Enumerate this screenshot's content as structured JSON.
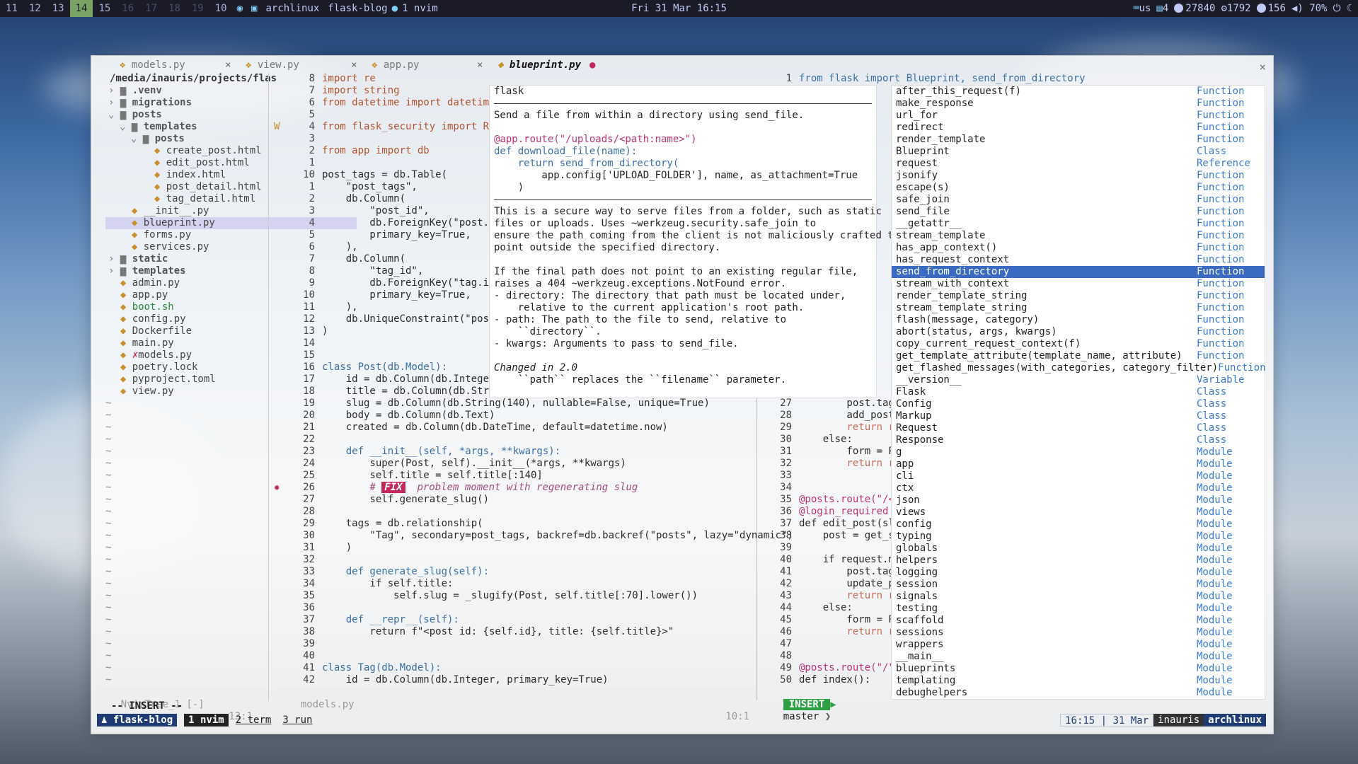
{
  "topbar": {
    "workspaces": [
      {
        "label": "11",
        "state": "normal"
      },
      {
        "label": "12",
        "state": "normal"
      },
      {
        "label": "13",
        "state": "normal"
      },
      {
        "label": "14",
        "state": "active"
      },
      {
        "label": "15",
        "state": "normal"
      },
      {
        "label": "16",
        "state": "dim"
      },
      {
        "label": "17",
        "state": "dim"
      },
      {
        "label": "18",
        "state": "dim"
      },
      {
        "label": "19",
        "state": "dim"
      },
      {
        "label": "10",
        "state": "normal"
      }
    ],
    "window_title_host": "archlinux",
    "window_title_session": "flask-blog",
    "window_title_pane": "1 nvim",
    "clock": "Fri 31 Mar 16:15",
    "tray": {
      "keyboard": "us",
      "windows": "4",
      "coins": "27840",
      "memory": "1792",
      "temp": "156",
      "volume": "70%"
    }
  },
  "window": {
    "close_label": "×"
  },
  "tabs": [
    {
      "label": "models.py",
      "close": "×",
      "current": false
    },
    {
      "label": "view.py",
      "close": "×",
      "current": false
    },
    {
      "label": "app.py",
      "close": "×",
      "current": false
    },
    {
      "label": "blueprint.py",
      "close": "●",
      "current": true
    }
  ],
  "tree": {
    "root": "/media/inauris/projects/flas",
    "items": [
      {
        "indent": 0,
        "fold": ">",
        "name": ".venv",
        "type": "dir"
      },
      {
        "indent": 0,
        "fold": ">",
        "name": "migrations",
        "type": "dir"
      },
      {
        "indent": 0,
        "fold": "v",
        "name": "posts",
        "type": "dir"
      },
      {
        "indent": 1,
        "fold": "v",
        "name": "templates",
        "type": "dir"
      },
      {
        "indent": 2,
        "fold": "v",
        "name": "posts",
        "type": "dir"
      },
      {
        "indent": 3,
        "fold": "",
        "name": "create_post.html",
        "type": "file"
      },
      {
        "indent": 3,
        "fold": "",
        "name": "edit_post.html",
        "type": "file"
      },
      {
        "indent": 3,
        "fold": "",
        "name": "index.html",
        "type": "file"
      },
      {
        "indent": 3,
        "fold": "",
        "name": "post_detail.html",
        "type": "file"
      },
      {
        "indent": 3,
        "fold": "",
        "name": "tag_detail.html",
        "type": "file"
      },
      {
        "indent": 1,
        "fold": "",
        "name": "__init__.py",
        "type": "file"
      },
      {
        "indent": 1,
        "fold": "",
        "name": "blueprint.py",
        "type": "file",
        "selected": true
      },
      {
        "indent": 1,
        "fold": "",
        "name": "forms.py",
        "type": "file"
      },
      {
        "indent": 1,
        "fold": "",
        "name": "services.py",
        "type": "file"
      },
      {
        "indent": 0,
        "fold": ">",
        "name": "static",
        "type": "dir"
      },
      {
        "indent": 0,
        "fold": ">",
        "name": "templates",
        "type": "dir"
      },
      {
        "indent": 0,
        "fold": "",
        "name": "admin.py",
        "type": "file"
      },
      {
        "indent": 0,
        "fold": "",
        "name": "app.py",
        "type": "file"
      },
      {
        "indent": 0,
        "fold": "",
        "name": "boot.sh",
        "type": "file"
      },
      {
        "indent": 0,
        "fold": "",
        "name": "config.py",
        "type": "file"
      },
      {
        "indent": 0,
        "fold": "",
        "name": "Dockerfile",
        "type": "file"
      },
      {
        "indent": 0,
        "fold": "",
        "name": "main.py",
        "type": "file"
      },
      {
        "indent": 0,
        "fold": "",
        "name": "models.py",
        "type": "file",
        "modified": "✗"
      },
      {
        "indent": 0,
        "fold": "",
        "name": "poetry.lock",
        "type": "file"
      },
      {
        "indent": 0,
        "fold": "",
        "name": "pyproject.toml",
        "type": "file"
      },
      {
        "indent": 0,
        "fold": "",
        "name": "view.py",
        "type": "file"
      }
    ],
    "filler": "~"
  },
  "code_left": [
    {
      "n": "8",
      "t": "import re"
    },
    {
      "n": "7",
      "t": "import string"
    },
    {
      "n": "6",
      "t": "from datetime import datetime"
    },
    {
      "n": "5",
      "t": ""
    },
    {
      "n": "4",
      "t": "from flask_security import RoleM",
      "sign": "W"
    },
    {
      "n": "3",
      "t": ""
    },
    {
      "n": "2",
      "t": "from app import db"
    },
    {
      "n": "1",
      "t": ""
    },
    {
      "n": "10",
      "t": "post_tags = db.Table("
    },
    {
      "n": "1",
      "t": "    \"post_tags\","
    },
    {
      "n": "2",
      "t": "    db.Column("
    },
    {
      "n": "3",
      "t": "        \"post_id\","
    },
    {
      "n": "4",
      "t": "        db.ForeignKey(\"post.id\","
    },
    {
      "n": "5",
      "t": "        primary_key=True,"
    },
    {
      "n": "6",
      "t": "    ),"
    },
    {
      "n": "7",
      "t": "    db.Column("
    },
    {
      "n": "8",
      "t": "        \"tag_id\","
    },
    {
      "n": "9",
      "t": "        db.ForeignKey(\"tag.id\","
    },
    {
      "n": "10",
      "t": "        primary_key=True,"
    },
    {
      "n": "11",
      "t": "    ),"
    },
    {
      "n": "12",
      "t": "    db.UniqueConstraint(\"post_id"
    },
    {
      "n": "13",
      "t": ")"
    },
    {
      "n": "14",
      "t": ""
    },
    {
      "n": "15",
      "t": ""
    },
    {
      "n": "16",
      "t": "class Post(db.Model):"
    },
    {
      "n": "17",
      "t": "    id = db.Column(db.Integer, p"
    },
    {
      "n": "18",
      "t": "    title = db.Column(db.String("
    },
    {
      "n": "19",
      "t": "    slug = db.Column(db.String(140), nullable=False, unique=True)"
    },
    {
      "n": "20",
      "t": "    body = db.Column(db.Text)"
    },
    {
      "n": "21",
      "t": "    created = db.Column(db.DateTime, default=datetime.now)"
    },
    {
      "n": "22",
      "t": ""
    },
    {
      "n": "23",
      "t": "    def __init__(self, *args, **kwargs):"
    },
    {
      "n": "24",
      "t": "        super(Post, self).__init__(*args, **kwargs)"
    },
    {
      "n": "25",
      "t": "        self.title = self.title[:140]"
    },
    {
      "n": "26",
      "t": "        # FIX  problem moment with regenerating slug",
      "sign": "bug"
    },
    {
      "n": "27",
      "t": "        self.generate_slug()"
    },
    {
      "n": "28",
      "t": ""
    },
    {
      "n": "29",
      "t": "    tags = db.relationship("
    },
    {
      "n": "30",
      "t": "        \"Tag\", secondary=post_tags, backref=db.backref(\"posts\", lazy=\"dynamic\")"
    },
    {
      "n": "31",
      "t": "    )"
    },
    {
      "n": "32",
      "t": ""
    },
    {
      "n": "33",
      "t": "    def generate_slug(self):"
    },
    {
      "n": "34",
      "t": "        if self.title:"
    },
    {
      "n": "35",
      "t": "            self.slug = _slugify(Post, self.title[:70].lower())"
    },
    {
      "n": "36",
      "t": ""
    },
    {
      "n": "37",
      "t": "    def __repr__(self):"
    },
    {
      "n": "38",
      "t": "        return f\"<post id: {self.id}, title: {self.title}>\""
    },
    {
      "n": "39",
      "t": ""
    },
    {
      "n": "40",
      "t": ""
    },
    {
      "n": "41",
      "t": "class Tag(db.Model):"
    },
    {
      "n": "42",
      "t": "    id = db.Column(db.Integer, primary_key=True)"
    }
  ],
  "code_right_top": {
    "n": "1",
    "t": "from flask import Blueprint, send_from_directory"
  },
  "code_right": [
    {
      "n": "27",
      "t": "        post.tags"
    },
    {
      "n": "28",
      "t": "        add_post_"
    },
    {
      "n": "29",
      "t": "        return re"
    },
    {
      "n": "30",
      "t": "    else:"
    },
    {
      "n": "31",
      "t": "        form = Po"
    },
    {
      "n": "32",
      "t": "        return re"
    },
    {
      "n": "33",
      "t": ""
    },
    {
      "n": "34",
      "t": ""
    },
    {
      "n": "35",
      "t": "@posts.route(\"/<s"
    },
    {
      "n": "36",
      "t": "@login_required"
    },
    {
      "n": "37",
      "t": "def edit_post(slu"
    },
    {
      "n": "38",
      "t": "    post = get_sp"
    },
    {
      "n": "39",
      "t": ""
    },
    {
      "n": "40",
      "t": "    if request.me"
    },
    {
      "n": "41",
      "t": "        post.tags"
    },
    {
      "n": "42",
      "t": "        update_po"
    },
    {
      "n": "43",
      "t": "        return re"
    },
    {
      "n": "44",
      "t": "    else:"
    },
    {
      "n": "45",
      "t": "        form = Po"
    },
    {
      "n": "46",
      "t": "        return re"
    },
    {
      "n": "47",
      "t": ""
    },
    {
      "n": "48",
      "t": ""
    },
    {
      "n": "49",
      "t": "@posts.route(\"/\")"
    },
    {
      "n": "50",
      "t": "def index():"
    }
  ],
  "doc": {
    "title": "flask",
    "lines": [
      "Send a file from within a directory using send_file.",
      "",
      "@app.route(\"/uploads/<path:name>\")",
      "def download_file(name):",
      "    return send_from_directory(",
      "        app.config['UPLOAD_FOLDER'], name, as_attachment=True",
      "    )"
    ],
    "lines2": [
      "This is a secure way to serve files from a folder, such as static",
      "files or uploads. Uses ~werkzeug.security.safe_join to",
      "ensure the path coming from the client is not maliciously crafted to",
      "point outside the specified directory.",
      "",
      "If the final path does not point to an existing regular file,",
      "raises a 404 ~werkzeug.exceptions.NotFound error.",
      "- directory: The directory that path must be located under,",
      "    relative to the current application's root path.",
      "- path: The path to the file to send, relative to",
      "    ``directory``.",
      "- kwargs: Arguments to pass to send_file.",
      "",
      "Changed in 2.0",
      "    ``path`` replaces the ``filename`` parameter."
    ]
  },
  "completion": [
    {
      "label": "after_this_request(f)",
      "kind": "Function"
    },
    {
      "label": "make_response",
      "kind": "Function"
    },
    {
      "label": "url_for",
      "kind": "Function"
    },
    {
      "label": "redirect",
      "kind": "Function"
    },
    {
      "label": "render_template",
      "kind": "Function"
    },
    {
      "label": "Blueprint",
      "kind": "Class"
    },
    {
      "label": "request",
      "kind": "Reference"
    },
    {
      "label": "jsonify",
      "kind": "Function"
    },
    {
      "label": "escape(s)",
      "kind": "Function"
    },
    {
      "label": "safe_join",
      "kind": "Function"
    },
    {
      "label": "send_file",
      "kind": "Function"
    },
    {
      "label": "__getattr__",
      "kind": "Function"
    },
    {
      "label": "stream_template",
      "kind": "Function"
    },
    {
      "label": "has_app_context()",
      "kind": "Function"
    },
    {
      "label": "has_request_context",
      "kind": "Function"
    },
    {
      "label": "send_from_directory",
      "kind": "Function",
      "selected": true
    },
    {
      "label": "stream_with_context",
      "kind": "Function"
    },
    {
      "label": "render_template_string",
      "kind": "Function"
    },
    {
      "label": "stream_template_string",
      "kind": "Function"
    },
    {
      "label": "flash(message, category)",
      "kind": "Function"
    },
    {
      "label": "abort(status, args, kwargs)",
      "kind": "Function"
    },
    {
      "label": "copy_current_request_context(f)",
      "kind": "Function"
    },
    {
      "label": "get_template_attribute(template_name, attribute)",
      "kind": "Function"
    },
    {
      "label": "get_flashed_messages(with_categories, category_filter)",
      "kind": "Function"
    },
    {
      "label": "__version__",
      "kind": "Variable"
    },
    {
      "label": "Flask",
      "kind": "Class"
    },
    {
      "label": "Config",
      "kind": "Class"
    },
    {
      "label": "Markup",
      "kind": "Class"
    },
    {
      "label": "Request",
      "kind": "Class"
    },
    {
      "label": "Response",
      "kind": "Class"
    },
    {
      "label": "g",
      "kind": "Module"
    },
    {
      "label": "app",
      "kind": "Module"
    },
    {
      "label": "cli",
      "kind": "Module"
    },
    {
      "label": "ctx",
      "kind": "Module"
    },
    {
      "label": "json",
      "kind": "Module"
    },
    {
      "label": "views",
      "kind": "Module"
    },
    {
      "label": "config",
      "kind": "Module"
    },
    {
      "label": "typing",
      "kind": "Module"
    },
    {
      "label": "globals",
      "kind": "Module"
    },
    {
      "label": "helpers",
      "kind": "Module"
    },
    {
      "label": "logging",
      "kind": "Module"
    },
    {
      "label": "session",
      "kind": "Module"
    },
    {
      "label": "signals",
      "kind": "Module"
    },
    {
      "label": "testing",
      "kind": "Module"
    },
    {
      "label": "scaffold",
      "kind": "Module"
    },
    {
      "label": "sessions",
      "kind": "Module"
    },
    {
      "label": "wrappers",
      "kind": "Module"
    },
    {
      "label": "__main__",
      "kind": "Module"
    },
    {
      "label": "blueprints",
      "kind": "Module"
    },
    {
      "label": "templating",
      "kind": "Module"
    },
    {
      "label": "debughelpers",
      "kind": "Module"
    }
  ],
  "statusline": {
    "tree_name": "NvimTree_1 [-]",
    "tree_pos": "13:1",
    "left_file": "models.py",
    "left_pos": "10:1",
    "mode": "INSERT",
    "branch": "master",
    "cmdline": "-- INSERT --"
  },
  "tmux": {
    "session": "flask-blog",
    "windows": [
      {
        "label": "1 nvim",
        "active": true
      },
      {
        "label": "2 term",
        "active": false
      },
      {
        "label": "3 run",
        "active": false
      }
    ],
    "time": "16:15",
    "date": "31 Mar",
    "user": "inauris",
    "host": "archlinux"
  },
  "colors": {
    "accent": "#3b6ac2",
    "insert_mode": "#2ea043",
    "tmux_bar": "#1f3b73",
    "workspace_active": "#7aa264"
  }
}
